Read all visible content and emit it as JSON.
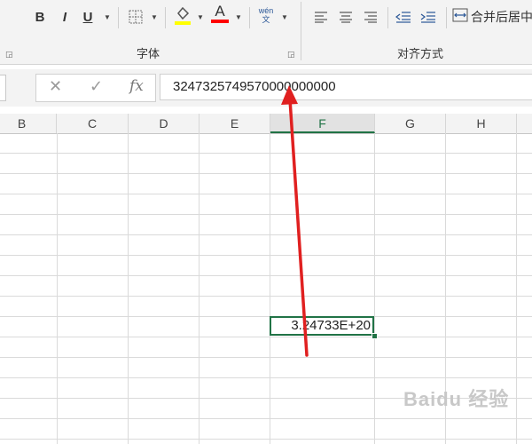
{
  "ribbon": {
    "font_buttons": {
      "bold": "B",
      "italic": "I",
      "underline": "U",
      "font_color": "A",
      "phonetic": "wén\n文"
    },
    "merge_center_label": "合并后居中",
    "groups": {
      "font": "字体",
      "alignment": "对齐方式"
    }
  },
  "formula_bar": {
    "cancel": "✕",
    "enter": "✓",
    "function": "fx",
    "value": "3247325749570000000000"
  },
  "columns": [
    "B",
    "C",
    "D",
    "E",
    "F",
    "G",
    "H"
  ],
  "selected_column": "F",
  "active_cell": {
    "display": "3.24733E+20"
  },
  "colors": {
    "accent_green": "#217346",
    "fill_highlight": "#ffff00",
    "font_color_bar": "#ff0000",
    "arrow": "#e02020"
  },
  "watermark": "Baidu 经验"
}
